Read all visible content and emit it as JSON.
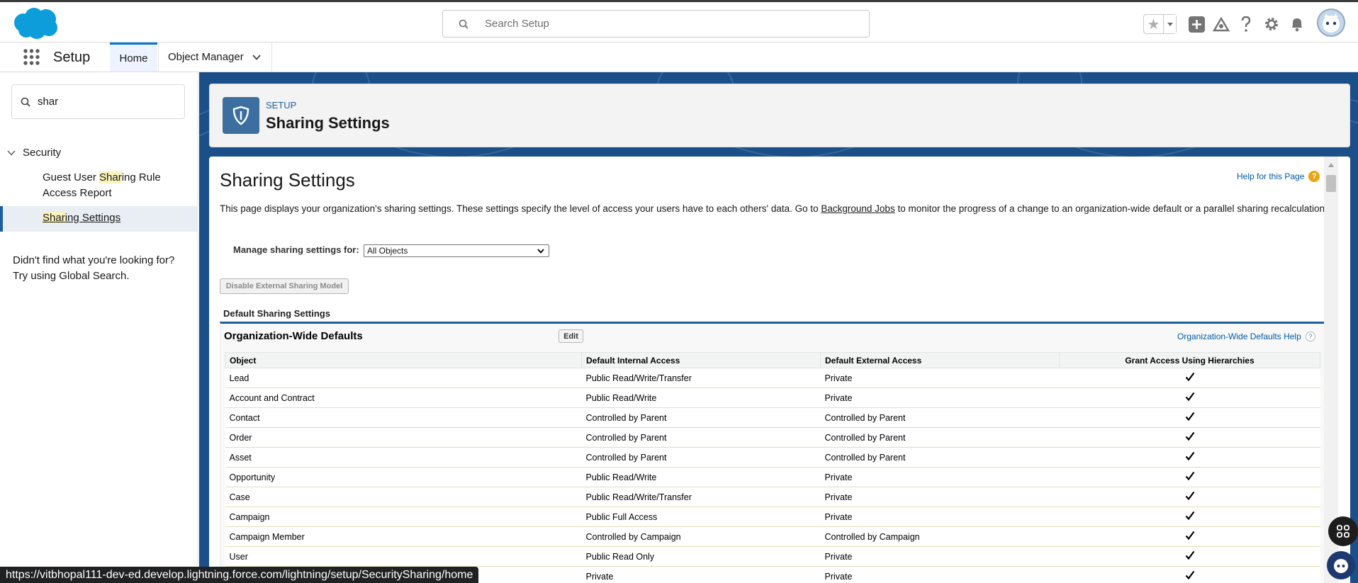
{
  "header": {
    "search_placeholder": "Search Setup",
    "icons": [
      "salesforce-logo",
      "star-icon",
      "chevron-down-icon",
      "add-icon",
      "trailhead-icon",
      "help-icon",
      "gear-icon",
      "bell-icon",
      "avatar"
    ]
  },
  "nav": {
    "app_name": "Setup",
    "tabs": [
      {
        "label": "Home",
        "active": true
      },
      {
        "label": "Object Manager",
        "active": false
      }
    ]
  },
  "sidebar": {
    "quick_find_value": "shar",
    "section": "Security",
    "items": [
      {
        "pre": "Guest User ",
        "hl": "Shar",
        "post": "ing Rule Access Report"
      },
      {
        "pre": "",
        "hl": "Shar",
        "post": "ing Settings",
        "active": true
      }
    ],
    "not_found": "Didn't find what you're looking for? Try using Global Search."
  },
  "page_header": {
    "kicker": "SETUP",
    "title": "Sharing Settings"
  },
  "content": {
    "title": "Sharing Settings",
    "help_link": "Help for this Page",
    "intro_before": "This page displays your organization's sharing settings. These settings specify the level of access your users have to each others' data. Go to ",
    "intro_link": "Background Jobs",
    "intro_after": " to monitor the progress of a change to an organization-wide default or a parallel sharing recalculation.",
    "manage_label": "Manage sharing settings for:",
    "manage_value": "All Objects",
    "disable_button": "Disable External Sharing Model",
    "default_section": "Default Sharing Settings",
    "owd_title": "Organization-Wide Defaults",
    "edit_button": "Edit",
    "owd_help": "Organization-Wide Defaults Help",
    "columns": [
      "Object",
      "Default Internal Access",
      "Default External Access",
      "Grant Access Using Hierarchies"
    ],
    "rows": [
      [
        "Lead",
        "Public Read/Write/Transfer",
        "Private"
      ],
      [
        "Account and Contract",
        "Public Read/Write",
        "Private"
      ],
      [
        "Contact",
        "Controlled by Parent",
        "Controlled by Parent"
      ],
      [
        "Order",
        "Controlled by Parent",
        "Controlled by Parent"
      ],
      [
        "Asset",
        "Controlled by Parent",
        "Controlled by Parent"
      ],
      [
        "Opportunity",
        "Public Read/Write",
        "Private"
      ],
      [
        "Case",
        "Public Read/Write/Transfer",
        "Private"
      ],
      [
        "Campaign",
        "Public Full Access",
        "Private"
      ],
      [
        "Campaign Member",
        "Controlled by Campaign",
        "Controlled by Campaign"
      ],
      [
        "User",
        "Public Read Only",
        "Private"
      ],
      [
        "",
        "Private",
        "Private"
      ]
    ]
  },
  "status_url": "https://vitbhopal111-dev-ed.develop.lightning.force.com/lightning/setup/SecuritySharing/home"
}
